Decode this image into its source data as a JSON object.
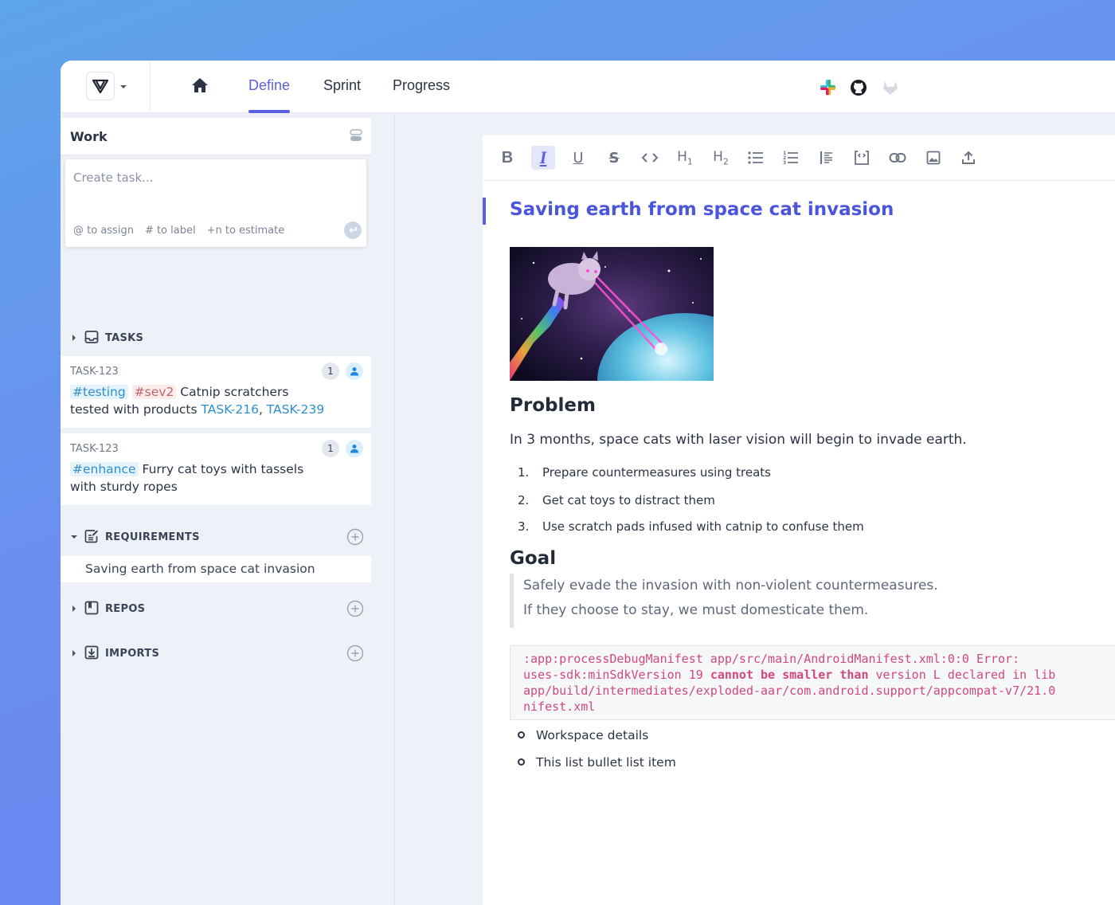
{
  "nav": {
    "tabs": [
      {
        "label": "Define",
        "active": true
      },
      {
        "label": "Sprint",
        "active": false
      },
      {
        "label": "Progress",
        "active": false
      }
    ],
    "integrations": [
      "slack-icon",
      "github-icon",
      "gitlab-icon"
    ]
  },
  "work": {
    "title": "Work",
    "create_placeholder": "Create task...",
    "hints": [
      "@ to assign",
      "# to label",
      "+n to estimate"
    ]
  },
  "sections": {
    "tasks": {
      "label": "TASKS"
    },
    "requirements": {
      "label": "REQUIREMENTS",
      "items": [
        "Saving earth from space cat invasion"
      ]
    },
    "repos": {
      "label": "REPOS"
    },
    "imports": {
      "label": "IMPORTS"
    }
  },
  "tasks": [
    {
      "id": "TASK-123",
      "tags": [
        "#testing",
        "#sev2"
      ],
      "text": "Catnip scratchers",
      "text2": "tested with products",
      "links": [
        "TASK-216",
        "TASK-239"
      ],
      "count": "1"
    },
    {
      "id": "TASK-123",
      "tags": [
        "#enhance"
      ],
      "text": "Furry cat toys with tassels",
      "text2": "with sturdy ropes",
      "count": "1"
    }
  ],
  "toolbar": [
    "bold",
    "italic",
    "underline",
    "strikethrough",
    "code",
    "heading-1",
    "heading-2",
    "bullet-list",
    "numbered-list",
    "blockquote",
    "code-block",
    "link",
    "image",
    "upload"
  ],
  "doc": {
    "title": "Saving earth from space cat invasion",
    "problem_heading": "Problem",
    "problem_text": "In 3 months, space cats with laser vision will begin to invade earth.",
    "steps": [
      {
        "num": "1.",
        "text": "Prepare countermeasures using treats"
      },
      {
        "num": "2.",
        "text": "Get cat toys to distract them"
      },
      {
        "num": "3.",
        "text": "Use scratch pads infused with catnip to confuse them"
      }
    ],
    "goal_heading": "Goal",
    "quote": [
      "Safely evade the invasion with non-violent countermeasures.",
      "If they choose to stay, we must domesticate them."
    ],
    "code": {
      "line1": ":app:processDebugManifest app/src/main/AndroidManifest.xml:0:0 Error:",
      "line2a": "uses-sdk:minSdkVersion 19 ",
      "line2b": "cannot be smaller than",
      "line2c": " version L declared in lib",
      "line3": "app/build/intermediates/exploded-aar/com.android.support/appcompat-v7/21.0",
      "line4": "nifest.xml"
    },
    "bullets": [
      "Workspace details",
      "This list bullet list item"
    ]
  },
  "colors": {
    "accent": "#5b5fe0",
    "tag_blue": "#2c8fd0",
    "tag_red": "#c46464",
    "code": "#d1497a"
  }
}
